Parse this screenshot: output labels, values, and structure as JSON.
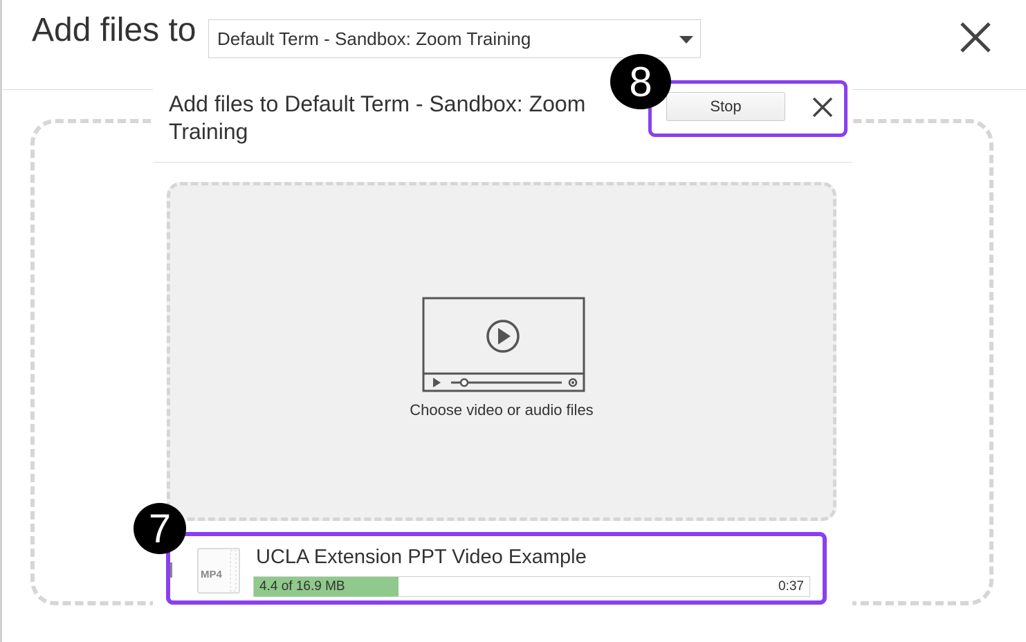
{
  "header": {
    "title": "Add files to",
    "term_select_value": "Default Term - Sandbox: Zoom Training"
  },
  "dialog": {
    "title": "Add files to Default Term - Sandbox: Zoom Training",
    "stop_label": "Stop",
    "drop_label": "Choose video or audio files"
  },
  "upload": {
    "file_type": "MP4",
    "file_name": "UCLA Extension PPT Video Example",
    "progress_text": "4.4 of 16.9 MB",
    "progress_fraction": 0.26,
    "time_remaining": "0:37"
  },
  "callouts": {
    "stop_badge": "8",
    "file_badge": "7"
  },
  "colors": {
    "highlight": "#8a3ff0",
    "progress": "#8fc98b",
    "badge": "#000000"
  },
  "icons": [
    "close-icon",
    "chevron-down-icon",
    "video-player-icon",
    "play-icon",
    "mp4-file-icon"
  ]
}
